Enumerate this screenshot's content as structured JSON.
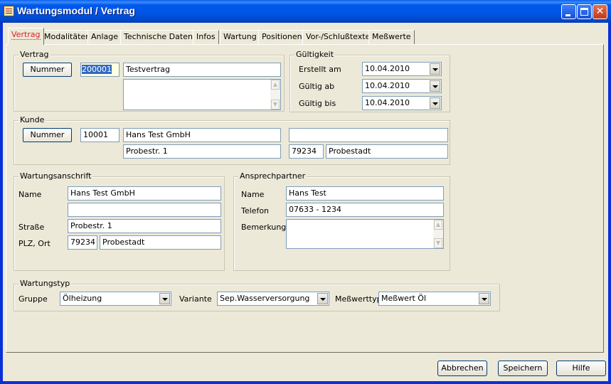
{
  "window": {
    "title": "Wartungsmodul / Vertrag"
  },
  "tabs": [
    {
      "label": "Vertrag",
      "active": true
    },
    {
      "label": "Modalitäten"
    },
    {
      "label": "Anlage"
    },
    {
      "label": "Technische Daten"
    },
    {
      "label": "Infos"
    },
    {
      "label": "Wartung"
    },
    {
      "label": "Positionen"
    },
    {
      "label": "Vor-/Schlußtexte"
    },
    {
      "label": "Meßwerte"
    }
  ],
  "vertrag": {
    "group_label": "Vertrag",
    "nummer_button": "Nummer",
    "nummer_value": "200001",
    "bezeichnung": "Testvertrag",
    "notiz": ""
  },
  "gueltigkeit": {
    "group_label": "Gültigkeit",
    "erstellt_label": "Erstellt am",
    "erstellt_value": "10.04.2010",
    "ab_label": "Gültig ab",
    "ab_value": "10.04.2010",
    "bis_label": "Gültig bis",
    "bis_value": "10.04.2010"
  },
  "kunde": {
    "group_label": "Kunde",
    "nummer_button": "Nummer",
    "nummer_value": "10001",
    "name": "Hans Test GmbH",
    "zusatz": "",
    "strasse": "Probestr. 1",
    "plz": "79234",
    "ort": "Probestadt"
  },
  "wartungsanschrift": {
    "group_label": "Wartungsanschrift",
    "name_label": "Name",
    "name": "Hans Test GmbH",
    "name2": "",
    "strasse_label": "Straße",
    "strasse": "Probestr. 1",
    "plzort_label": "PLZ, Ort",
    "plz": "79234",
    "ort": "Probestadt"
  },
  "ansprechpartner": {
    "group_label": "Ansprechpartner",
    "name_label": "Name",
    "name": "Hans Test",
    "telefon_label": "Telefon",
    "telefon": "07633 - 1234",
    "bemerkung_label": "Bemerkung",
    "bemerkung": ""
  },
  "wartungstyp": {
    "group_label": "Wartungstyp",
    "gruppe_label": "Gruppe",
    "gruppe_value": "Ölheizung",
    "variante_label": "Variante",
    "variante_value": "Sep.Wasserversorgung",
    "messwerttyp_label": "Meßwerttyp",
    "messwerttyp_value": "Meßwert Öl"
  },
  "footer": {
    "abbrechen": "Abbrechen",
    "speichern": "Speichern",
    "hilfe": "Hilfe"
  }
}
